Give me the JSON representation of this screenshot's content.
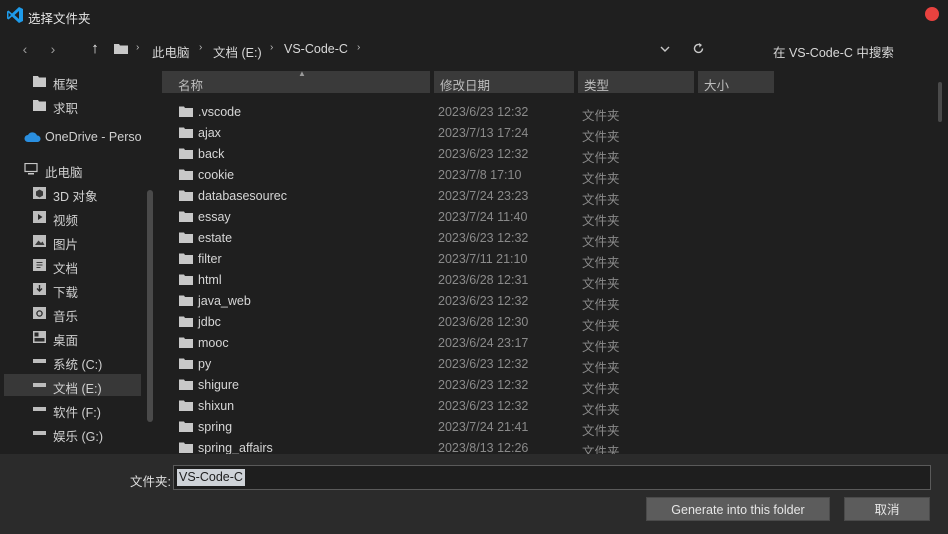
{
  "window": {
    "title": "选择文件夹",
    "icon": "vscode-icon",
    "close_color": "#e8423f"
  },
  "nav": {
    "back": "‹",
    "forward": "›",
    "up": "↑",
    "breadcrumbs": [
      "此电脑",
      "文档 (E:)",
      "VS-Code-C"
    ],
    "search_placeholder": "在 VS-Code-C 中搜索"
  },
  "sidebar": {
    "items": [
      {
        "label": "框架",
        "icon": "folder-icon"
      },
      {
        "label": "求职",
        "icon": "folder-icon"
      },
      {
        "label": "OneDrive - Perso",
        "icon": "onedrive-cloud-icon"
      },
      {
        "label": "此电脑",
        "icon": "computer-icon"
      },
      {
        "label": "3D 对象",
        "icon": "3d-objects-icon"
      },
      {
        "label": "视频",
        "icon": "video-icon"
      },
      {
        "label": "图片",
        "icon": "picture-icon"
      },
      {
        "label": "文档",
        "icon": "document-icon"
      },
      {
        "label": "下载",
        "icon": "download-icon"
      },
      {
        "label": "音乐",
        "icon": "music-icon"
      },
      {
        "label": "桌面",
        "icon": "desktop-icon"
      },
      {
        "label": "系统 (C:)",
        "icon": "drive-icon"
      },
      {
        "label": "文档 (E:)",
        "icon": "drive-icon",
        "active": true
      },
      {
        "label": "软件 (F:)",
        "icon": "drive-icon"
      },
      {
        "label": "娱乐 (G:)",
        "icon": "drive-icon"
      }
    ]
  },
  "columns": {
    "name": "名称",
    "date": "修改日期",
    "type": "类型",
    "size": "大小"
  },
  "files": [
    {
      "name": ".vscode",
      "date": "2023/6/23 12:32",
      "type": "文件夹"
    },
    {
      "name": "ajax",
      "date": "2023/7/13 17:24",
      "type": "文件夹"
    },
    {
      "name": "back",
      "date": "2023/6/23 12:32",
      "type": "文件夹"
    },
    {
      "name": "cookie",
      "date": "2023/7/8 17:10",
      "type": "文件夹"
    },
    {
      "name": "databasesourec",
      "date": "2023/7/24 23:23",
      "type": "文件夹"
    },
    {
      "name": "essay",
      "date": "2023/7/24 11:40",
      "type": "文件夹"
    },
    {
      "name": "estate",
      "date": "2023/6/23 12:32",
      "type": "文件夹"
    },
    {
      "name": "filter",
      "date": "2023/7/11 21:10",
      "type": "文件夹"
    },
    {
      "name": "html",
      "date": "2023/6/28 12:31",
      "type": "文件夹"
    },
    {
      "name": "java_web",
      "date": "2023/6/23 12:32",
      "type": "文件夹"
    },
    {
      "name": "jdbc",
      "date": "2023/6/28 12:30",
      "type": "文件夹"
    },
    {
      "name": "mooc",
      "date": "2023/6/24 23:17",
      "type": "文件夹"
    },
    {
      "name": "py",
      "date": "2023/6/23 12:32",
      "type": "文件夹"
    },
    {
      "name": "shigure",
      "date": "2023/6/23 12:32",
      "type": "文件夹"
    },
    {
      "name": "shixun",
      "date": "2023/6/23 12:32",
      "type": "文件夹"
    },
    {
      "name": "spring",
      "date": "2023/7/24 21:41",
      "type": "文件夹"
    },
    {
      "name": "spring_affairs",
      "date": "2023/8/13 12:26",
      "type": "文件夹"
    }
  ],
  "bottom": {
    "folder_label": "文件夹:",
    "folder_value": "VS-Code-C",
    "confirm_label": "Generate into this folder",
    "cancel_label": "取消"
  },
  "colors": {
    "background": "#1f1f1f",
    "folder": "#c8c8c8",
    "accent": "#1e9bea",
    "selection": "#383838"
  }
}
